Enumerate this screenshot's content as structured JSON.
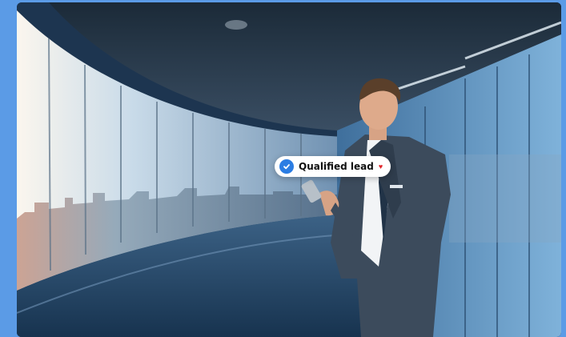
{
  "badge": {
    "label": "Qualified lead",
    "check_icon": "check-circle-icon",
    "heart_icon": "heart-icon",
    "check_color": "#2b7de3",
    "heart_color": "#e0262b"
  },
  "colors": {
    "page_background": "#5b9be6",
    "suit": "#3c4b5c"
  }
}
